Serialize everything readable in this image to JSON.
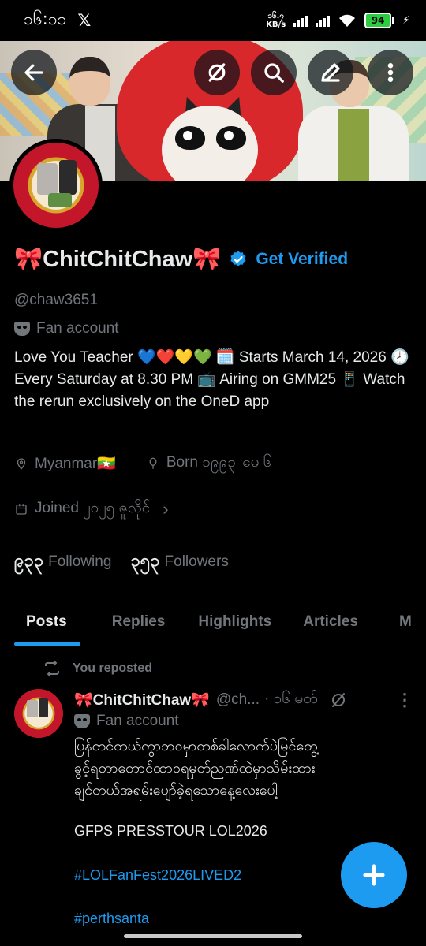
{
  "status_bar": {
    "time": "၁၆:၁၁",
    "x_logo": "𝕏",
    "net_speed_value": "၁၆.၇",
    "net_speed_unit": "KB/s",
    "battery": "94"
  },
  "profile": {
    "display_name": "🎀ChitChitChaw🎀",
    "get_verified": "Get Verified",
    "handle": "@chaw3651",
    "category": "Fan account",
    "bio": "Love You Teacher 💙❤️💛💚 🗓️ Starts March 14, 2026 🕗 Every Saturday at 8.30 PM 📺 Airing on GMM25 📱 Watch the rerun exclusively on the OneD app",
    "location": "Myanmar🇲🇲",
    "birthday": "Born ၁၉၉၃၊ မေ ၆",
    "joined": "Joined ၂၀၂၅ ဇူလိုင်",
    "following_count": "၉၃၃",
    "following_label": "Following",
    "followers_count": "၃၅၃",
    "followers_label": "Followers"
  },
  "tabs": [
    "Posts",
    "Replies",
    "Highlights",
    "Articles",
    "M"
  ],
  "post": {
    "repost_label": "You reposted",
    "author": "🎀ChitChitChaw🎀",
    "handle": "@ch...",
    "time": "· ၁၆ မတ်",
    "category": "Fan account",
    "text": "ပြန်တင်တယ်ကွာဘဝမှာတစ်ခါလောက်ပဲမြင်တွေ့\nခွင့်ရတာတောင်ထာဝရမှတ်ညဏ်ထဲမှာသိမ်းထား\nချင်တယ်အရမ်းပျော်ခဲ့ရသောနေ့လေးပေါ့",
    "line2": "GFPS PRESSTOUR LOL2026",
    "hashtags": [
      "#LOLFanFest2026LIVED2",
      "#perthsanta"
    ]
  },
  "colors": {
    "accent": "#1d9bf0",
    "muted": "#71767b",
    "text": "#e7e9ea",
    "background": "#000000"
  }
}
